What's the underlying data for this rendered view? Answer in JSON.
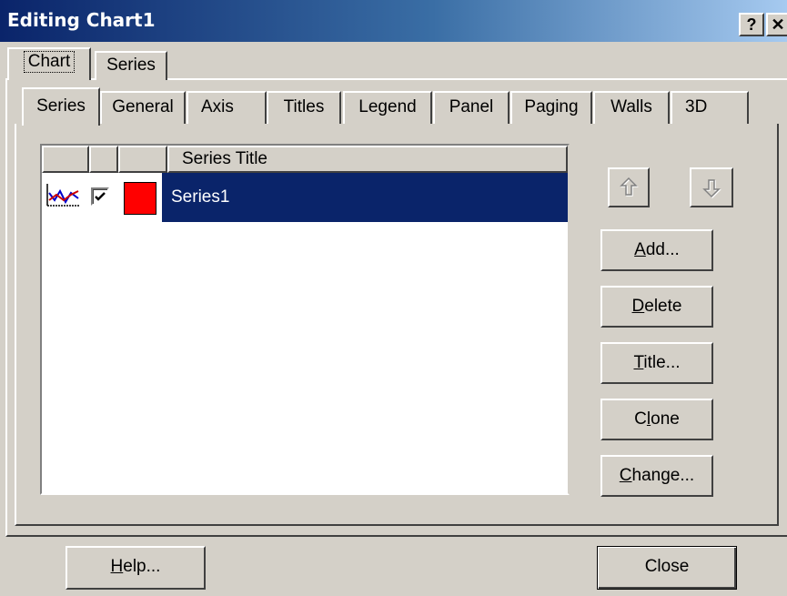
{
  "window": {
    "title": "Editing Chart1",
    "help_glyph": "?",
    "close_glyph": "✕"
  },
  "outer_tabs": [
    {
      "label": "Chart"
    },
    {
      "label": "Series"
    }
  ],
  "inner_tabs": [
    {
      "label": "Series"
    },
    {
      "label": "General"
    },
    {
      "label": "Axis"
    },
    {
      "label": "Titles"
    },
    {
      "label": "Legend"
    },
    {
      "label": "Panel"
    },
    {
      "label": "Paging"
    },
    {
      "label": "Walls"
    },
    {
      "label": "3D"
    }
  ],
  "series_list": {
    "column_header": "Series Title",
    "rows": [
      {
        "title": "Series1",
        "checked": true,
        "color": "#ff0000"
      }
    ]
  },
  "buttons": {
    "add": {
      "pre": "",
      "key": "A",
      "post": "dd..."
    },
    "delete": {
      "pre": "",
      "key": "D",
      "post": "elete"
    },
    "title": {
      "pre": "",
      "key": "T",
      "post": "itle..."
    },
    "clone": {
      "pre": "C",
      "key": "l",
      "post": "one"
    },
    "change": {
      "pre": "",
      "key": "C",
      "post": "hange..."
    },
    "help": {
      "pre": "",
      "key": "H",
      "post": "elp..."
    },
    "close": {
      "label": "Close"
    }
  },
  "colors": {
    "title_start": "#0a246a",
    "title_end": "#a6caf0",
    "selection": "#0a246a",
    "face": "#d4d0c8"
  }
}
